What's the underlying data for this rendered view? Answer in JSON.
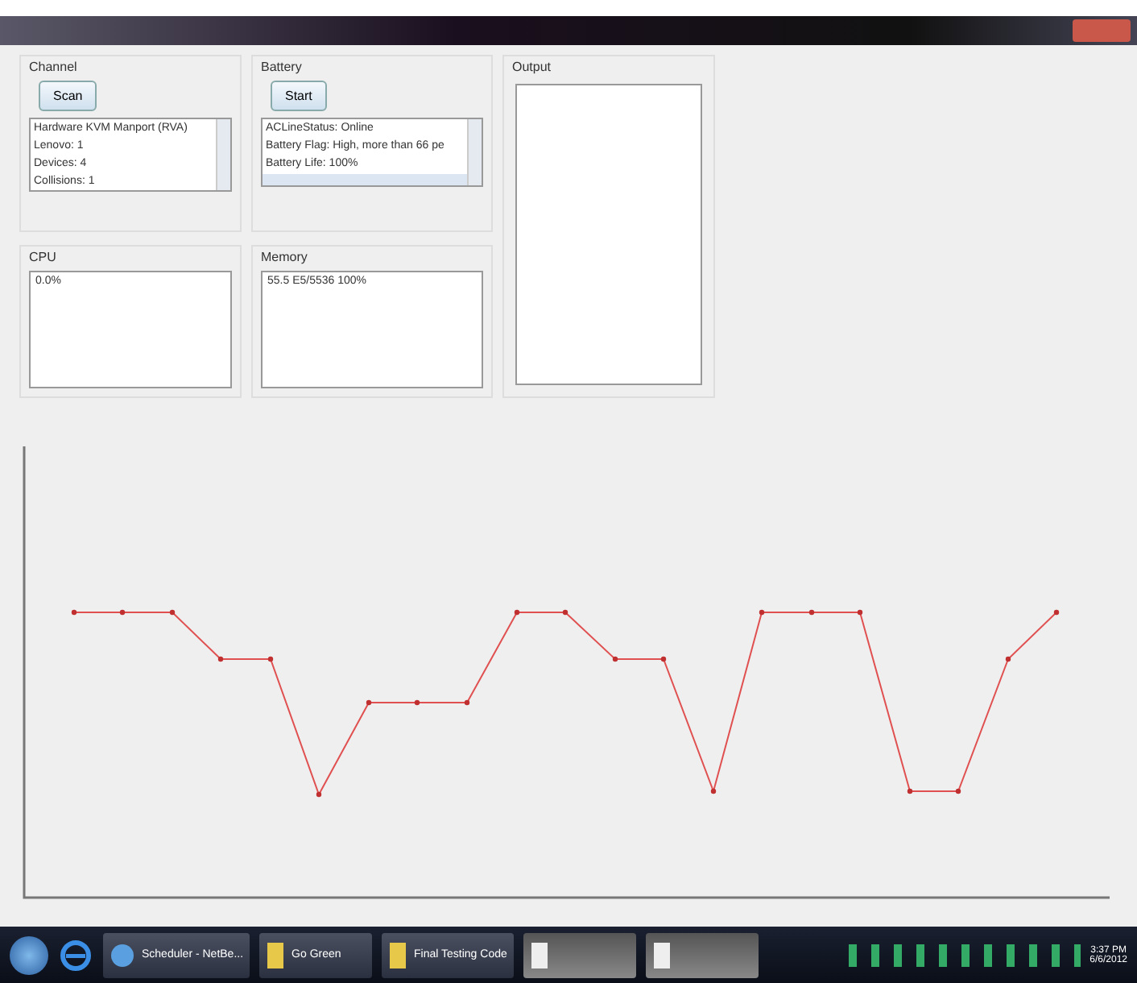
{
  "channel": {
    "title": "Channel",
    "button": "Scan",
    "items": [
      "Hardware KVM Manport (RVA)",
      "Lenovo: 1",
      "Devices: 4",
      "Collisions: 1"
    ]
  },
  "battery": {
    "title": "Battery",
    "button": "Start",
    "items": [
      "ACLineStatus: Online",
      "Battery Flag: High, more than 66 pe",
      "Battery Life: 100%"
    ]
  },
  "output": {
    "title": "Output"
  },
  "cpu": {
    "title": "CPU",
    "value": "0.0%"
  },
  "memory": {
    "title": "Memory",
    "value": "55.5 E5/5536 100%"
  },
  "taskbar": {
    "items": [
      {
        "kind": "app",
        "label": "Scheduler - NetBe..."
      },
      {
        "kind": "folder",
        "label": "Go Green"
      },
      {
        "kind": "folder",
        "label": "Final Testing Code"
      },
      {
        "kind": "blank"
      },
      {
        "kind": "blank"
      }
    ],
    "time": "3:37 PM",
    "date": "6/6/2012"
  }
}
